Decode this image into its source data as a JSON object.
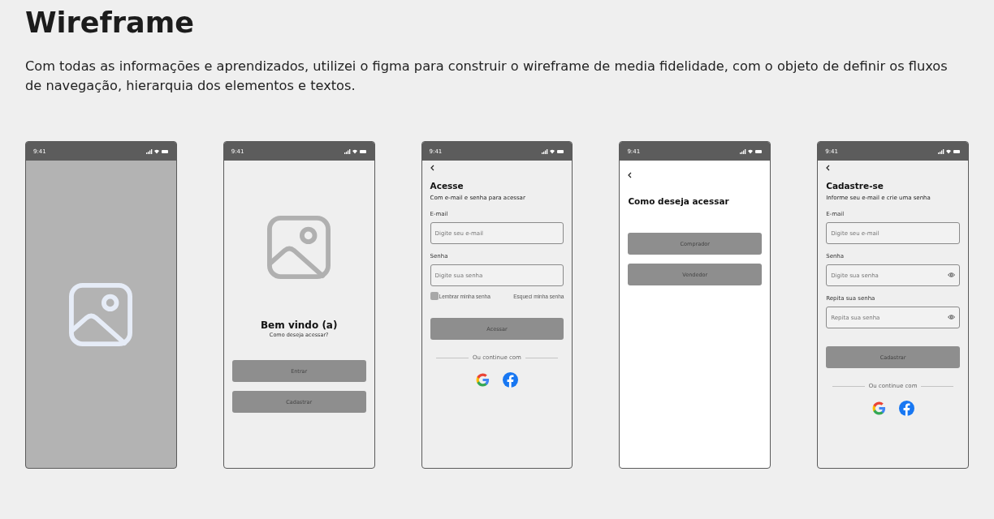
{
  "title": "Wireframe",
  "description": "Com todas as informações e aprendizados, utilizei o figma para construir o wireframe de media fidelidade, com o objeto de definir os fluxos de navegação, hierarquia dos elementos e textos.",
  "screens": [
    {
      "kind": "splash",
      "time": "9:41",
      "items": [
        {
          "kind": "image"
        }
      ]
    },
    {
      "kind": "welcome",
      "time": "9:41",
      "items": [
        {
          "kind": "image"
        },
        {
          "kind": "center-title",
          "text": "Bem vindo (a)"
        },
        {
          "kind": "center-subtitle",
          "text": "Como deseja acessar?"
        },
        {
          "kind": "button",
          "text": "Entrar"
        },
        {
          "kind": "button",
          "text": "Cadastrar"
        }
      ]
    },
    {
      "kind": "form",
      "time": "9:41",
      "items": [
        {
          "kind": "back"
        },
        {
          "kind": "heading",
          "text": "Acesse"
        },
        {
          "kind": "subtitle",
          "text": "Com e-mail e senha para acessar"
        },
        {
          "kind": "label",
          "text": "E-mail"
        },
        {
          "kind": "field",
          "placeholder": "Digite seu e-mail",
          "eye": false
        },
        {
          "kind": "label",
          "text": "Senha"
        },
        {
          "kind": "field",
          "placeholder": "Digite sua senha",
          "eye": false
        },
        {
          "kind": "checkrow",
          "text": "Lembrar minha senha",
          "link": "Esqueci minha senha",
          "checked": false
        },
        {
          "kind": "button",
          "text": "Acessar"
        },
        {
          "kind": "divider",
          "text": "Ou continue com"
        },
        {
          "kind": "social"
        }
      ]
    },
    {
      "kind": "choice",
      "time": "9:41",
      "items": [
        {
          "kind": "back"
        },
        {
          "kind": "heading",
          "text": "Como deseja acessar"
        },
        {
          "kind": "button",
          "text": "Comprador"
        },
        {
          "kind": "button",
          "text": "Vendedor"
        }
      ]
    },
    {
      "kind": "form",
      "time": "9:41",
      "items": [
        {
          "kind": "back"
        },
        {
          "kind": "heading",
          "text": "Cadastre-se"
        },
        {
          "kind": "subtitle",
          "text": "Informe seu e-mail e crie uma senha"
        },
        {
          "kind": "label",
          "text": "E-mail"
        },
        {
          "kind": "field",
          "placeholder": "Digite seu e-mail",
          "eye": false
        },
        {
          "kind": "label",
          "text": "Senha"
        },
        {
          "kind": "field",
          "placeholder": "Digite sua senha",
          "eye": true
        },
        {
          "kind": "label",
          "text": "Repita sua senha"
        },
        {
          "kind": "field",
          "placeholder": "Repita sua senha",
          "eye": true
        },
        {
          "kind": "button",
          "text": "Cadastrar"
        },
        {
          "kind": "divider",
          "text": "Ou continue com"
        },
        {
          "kind": "social"
        }
      ]
    }
  ]
}
